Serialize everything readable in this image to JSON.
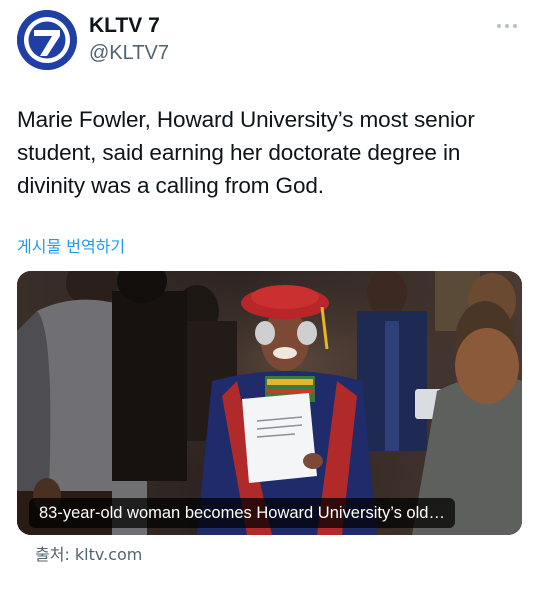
{
  "account": {
    "display_name": "KLTV 7",
    "handle": "@KLTV7",
    "avatar_icon": "kltv7-logo-icon",
    "brand_color": "#1f3fa6"
  },
  "menu": {
    "more_icon": "more-options-icon"
  },
  "tweet": {
    "text": "Marie Fowler, Howard University’s most senior student, said earning her doctorate degree in divinity was a calling from God.",
    "translate_label": "게시물 번역하기"
  },
  "link_card": {
    "image_icon": "graduation-photo",
    "caption": "83-year-old woman becomes Howard University’s old…",
    "source": "출처: kltv.com"
  },
  "colors": {
    "link": "#1d9bf0",
    "secondary_text": "#536471",
    "primary_text": "#0f1419"
  }
}
